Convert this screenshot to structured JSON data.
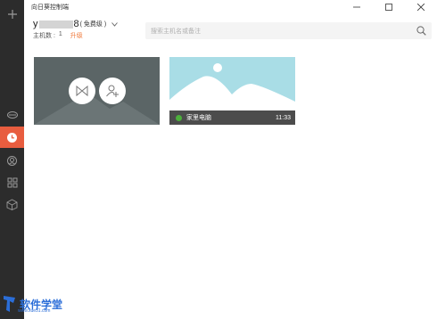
{
  "window": {
    "title": "向日葵控制端"
  },
  "account": {
    "name_prefix": "y",
    "name_suffix": "8",
    "tier": "( 免费级 )"
  },
  "hosts": {
    "count_label": "主机数 :",
    "count_value": "1",
    "upgrade_label": "升级"
  },
  "search": {
    "placeholder": "搜索主机名或备注"
  },
  "devices": [
    {
      "name": "家里电脑",
      "time": "11:33",
      "status_color": "#4caf3b"
    }
  ],
  "colors": {
    "accent": "#e85d3f",
    "upgrade": "#f07a3c",
    "sidebar": "#2c2c2c",
    "card_blank_bg": "#5b6566",
    "card_device_bg": "#a9dde6"
  },
  "icons": {
    "sidebar": [
      "plus-icon",
      "remote-control-icon",
      "clock-icon",
      "location-icon",
      "apps-icon",
      "box-icon"
    ],
    "card_actions": [
      "remote-desktop-icon",
      "add-user-icon"
    ]
  },
  "watermark": {
    "brand": "软件学堂",
    "url": "www.xue51.com"
  }
}
